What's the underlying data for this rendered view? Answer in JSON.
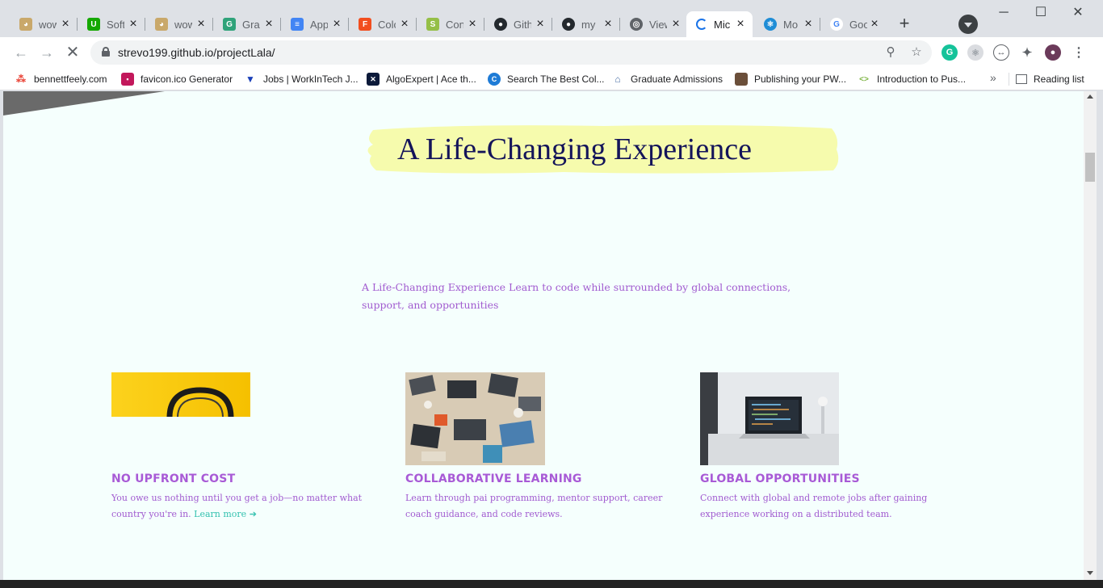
{
  "browser": {
    "tabs": [
      {
        "title": "wow",
        "icon": "doge-icon",
        "color": "#c9a86a"
      },
      {
        "title": "Soft",
        "icon": "upwork-icon",
        "color": "#14a800"
      },
      {
        "title": "wow",
        "icon": "doge-icon",
        "color": "#c9a86a"
      },
      {
        "title": "Gra",
        "icon": "grammar-icon",
        "color": "#2fa37a"
      },
      {
        "title": "App",
        "icon": "docs-icon",
        "color": "#4285f4"
      },
      {
        "title": "Colo",
        "icon": "figma-icon",
        "color": "#f24e1e"
      },
      {
        "title": "Con",
        "icon": "shopify-icon",
        "color": "#95bf47"
      },
      {
        "title": "Gith",
        "icon": "github-icon",
        "color": "#24292e"
      },
      {
        "title": "my",
        "icon": "github-icon",
        "color": "#24292e"
      },
      {
        "title": "View",
        "icon": "globe-icon",
        "color": "#5f6368"
      },
      {
        "title": "Mic",
        "icon": "loading-spinner-icon",
        "color": "#1a73e8",
        "active": true
      },
      {
        "title": "Mo",
        "icon": "react-icon",
        "color": "#1f8dd6"
      },
      {
        "title": "Goo",
        "icon": "google-icon",
        "color": "#4285f4"
      }
    ],
    "new_tab_label": "+",
    "url": "strevo199.github.io/projectLala/",
    "bookmarks": [
      {
        "label": "bennettfeely.com",
        "icon": "dots-icon",
        "color": "#e94235"
      },
      {
        "label": "favicon.ico Generator",
        "icon": "favicon-icon",
        "color": "#c2185b"
      },
      {
        "label": "Jobs | WorkInTech J...",
        "icon": "workintech-icon",
        "color": "#1a3fb8"
      },
      {
        "label": "AlgoExpert | Ace th...",
        "icon": "algoexpert-icon",
        "color": "#0c1a3a"
      },
      {
        "label": "Search The Best Col...",
        "icon": "college-icon",
        "color": "#1e7bd6"
      },
      {
        "label": "Graduate Admissions",
        "icon": "university-icon",
        "color": "#4a6fa5"
      },
      {
        "label": "Publishing your PW...",
        "icon": "thumbnail-icon",
        "color": "#6b4f3a"
      },
      {
        "label": "Introduction to Pus...",
        "icon": "code-icon",
        "color": "#7cb342"
      }
    ],
    "more_label": "»",
    "reading_list_label": "Reading list"
  },
  "page": {
    "heading": "A Life-Changing Experience",
    "intro": "A Life-Changing Experience Learn to code while surrounded by global connections, support, and opportunities",
    "features": [
      {
        "title": "NO UPFRONT COST",
        "text": "You owe us nothing until you get a job—no matter what country you're in.",
        "link": "Learn more"
      },
      {
        "title": "COLLABORATIVE LEARNING",
        "text": "Learn through pai programming, mentor support, career coach guidance, and code reviews."
      },
      {
        "title": "GLOBAL OPPORTUNITIES",
        "text": "Connect with global and remote jobs after gaining experience working on a distributed team."
      }
    ]
  },
  "colors": {
    "heading": "#14145a",
    "highlight": "#f6fbad",
    "accent_purple": "#a85ad6",
    "link_teal": "#35c2b0",
    "page_bg": "#f5fffd"
  }
}
